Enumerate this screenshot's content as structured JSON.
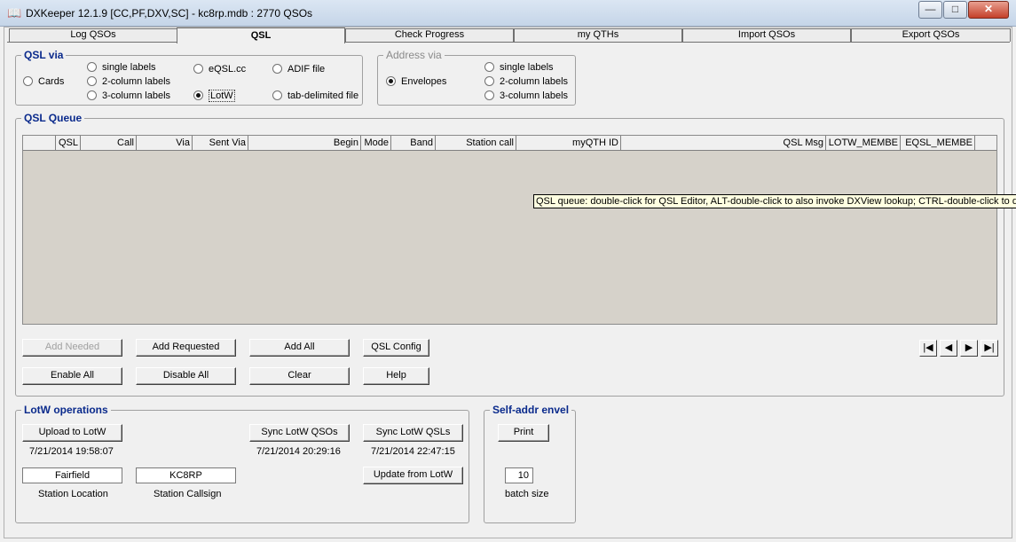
{
  "window": {
    "title": "DXKeeper 12.1.9 [CC,PF,DXV,SC] - kc8rp.mdb : 2770 QSOs",
    "minimize_glyph": "—",
    "maximize_glyph": "□",
    "close_glyph": "✕",
    "app_icon_glyph": "📖"
  },
  "tabs": [
    "Log QSOs",
    "QSL",
    "Check Progress",
    "my QTHs",
    "Import QSOs",
    "Export QSOs"
  ],
  "active_tab": "QSL",
  "qsl_via": {
    "legend": "QSL via",
    "options": [
      "Cards",
      "single labels",
      "2-column labels",
      "3-column labels",
      "eQSL.cc",
      "LotW",
      "ADIF file",
      "tab-delimited file"
    ],
    "selected": "LotW"
  },
  "address_via": {
    "legend": "Address via",
    "options": [
      "Envelopes",
      "single labels",
      "2-column labels",
      "3-column labels"
    ],
    "selected": "Envelopes"
  },
  "qsl_queue": {
    "legend": "QSL Queue",
    "columns": [
      "",
      "QSL",
      "Call",
      "Via",
      "Sent Via",
      "Begin",
      "Mode",
      "Band",
      "Station call",
      "myQTH ID",
      "QSL Msg",
      "LOTW_MEMBE",
      "EQSL_MEMBE"
    ],
    "tooltip": "QSL queue: double-click for QSL Editor, ALT-double-click to also invoke DXView lookup; CTRL-double-click to disp",
    "buttons": {
      "add_needed": "Add Needed",
      "add_requested": "Add Requested",
      "add_all": "Add All",
      "qsl_config": "QSL Config",
      "enable_all": "Enable All",
      "disable_all": "Disable All",
      "clear": "Clear",
      "help": "Help"
    },
    "nav": [
      "|◀",
      "◀",
      "▶",
      "▶|"
    ]
  },
  "lotw": {
    "legend": "LotW operations",
    "upload_button": "Upload to LotW",
    "upload_time": "7/21/2014 19:58:07",
    "sync_qsos_button": "Sync LotW QSOs",
    "sync_qsos_time": "7/21/2014 20:29:16",
    "sync_qsls_button": "Sync LotW QSLs",
    "sync_qsls_time": "7/21/2014 22:47:15",
    "update_button": "Update from LotW",
    "station_location": "Fairfield",
    "station_location_label": "Station Location",
    "station_callsign": "KC8RP",
    "station_callsign_label": "Station Callsign"
  },
  "self_addr": {
    "legend": "Self-addr envel",
    "print_button": "Print",
    "batch_size": "10",
    "batch_size_label": "batch size"
  }
}
